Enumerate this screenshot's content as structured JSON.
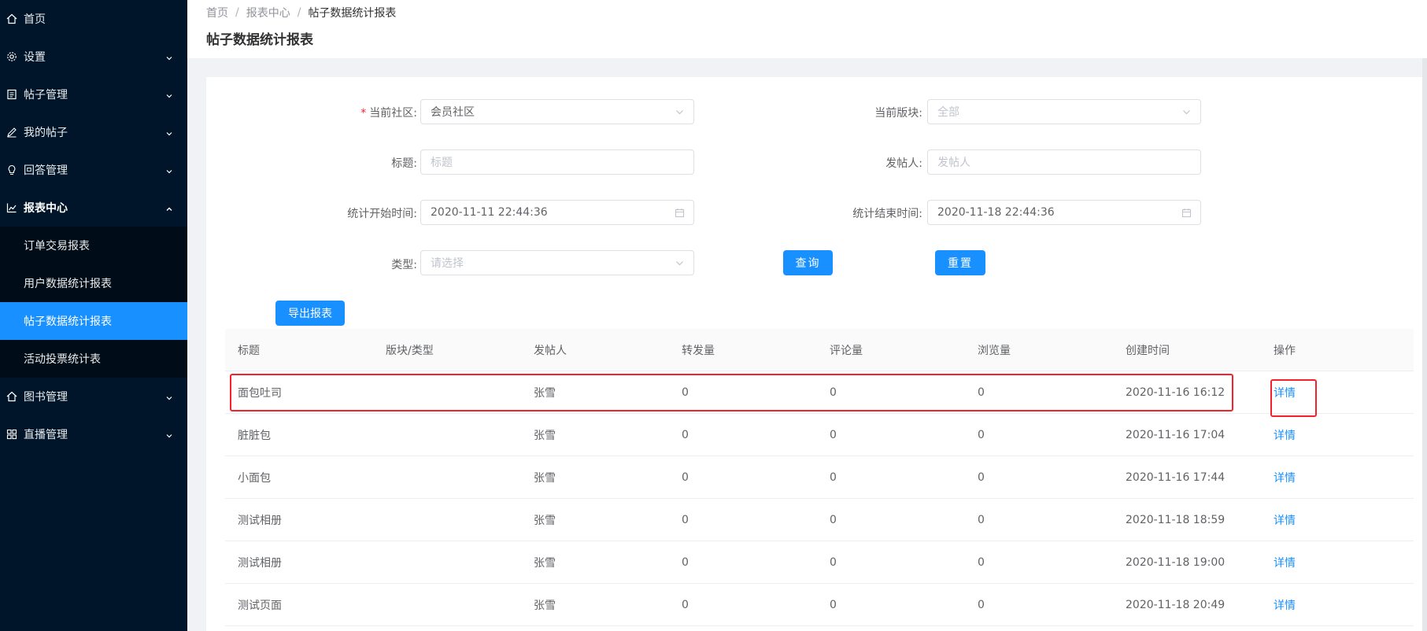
{
  "sidebar": {
    "home": "首页",
    "settings": "设置",
    "post_mgmt": "帖子管理",
    "my_posts": "我的帖子",
    "answers": "回答管理",
    "reports": "报表中心",
    "report_items": [
      "订单交易报表",
      "用户数据统计报表",
      "帖子数据统计报表",
      "活动投票统计表"
    ],
    "books": "图书管理",
    "live": "直播管理"
  },
  "breadcrumb": {
    "home": "首页",
    "reports": "报表中心",
    "current": "帖子数据统计报表"
  },
  "page_title": "帖子数据统计报表",
  "form": {
    "community_label": "当前社区:",
    "community_value": "会员社区",
    "board_label": "当前版块:",
    "board_placeholder": "全部",
    "title_label": "标题:",
    "title_placeholder": "标题",
    "poster_label": "发帖人:",
    "poster_placeholder": "发帖人",
    "start_label": "统计开始时间:",
    "start_value": "2020-11-11 22:44:36",
    "end_label": "统计结束时间:",
    "end_value": "2020-11-18 22:44:36",
    "type_label": "类型:",
    "type_placeholder": "请选择",
    "query_btn": "查询",
    "reset_btn": "重置",
    "export_btn": "导出报表"
  },
  "table": {
    "columns": [
      "标题",
      "版块/类型",
      "发帖人",
      "转发量",
      "评论量",
      "浏览量",
      "创建时间",
      "操作"
    ],
    "rows": [
      {
        "title": "面包吐司",
        "board": "",
        "poster": "张雪",
        "shares": "0",
        "comments": "0",
        "views": "0",
        "created": "2020-11-16 16:12",
        "action": "详情"
      },
      {
        "title": "脏脏包",
        "board": "",
        "poster": "张雪",
        "shares": "0",
        "comments": "0",
        "views": "0",
        "created": "2020-11-16 17:04",
        "action": "详情"
      },
      {
        "title": "小面包",
        "board": "",
        "poster": "张雪",
        "shares": "0",
        "comments": "0",
        "views": "0",
        "created": "2020-11-16 17:44",
        "action": "详情"
      },
      {
        "title": "测试相册",
        "board": "",
        "poster": "张雪",
        "shares": "0",
        "comments": "0",
        "views": "0",
        "created": "2020-11-18 18:59",
        "action": "详情"
      },
      {
        "title": "测试相册",
        "board": "",
        "poster": "张雪",
        "shares": "0",
        "comments": "0",
        "views": "0",
        "created": "2020-11-18 19:00",
        "action": "详情"
      },
      {
        "title": "测试页面",
        "board": "",
        "poster": "张雪",
        "shares": "0",
        "comments": "0",
        "views": "0",
        "created": "2020-11-18 20:49",
        "action": "详情"
      }
    ]
  },
  "colors": {
    "sidebar_bg": "#001529",
    "accent": "#1890ff",
    "highlight": "#f5222d"
  }
}
